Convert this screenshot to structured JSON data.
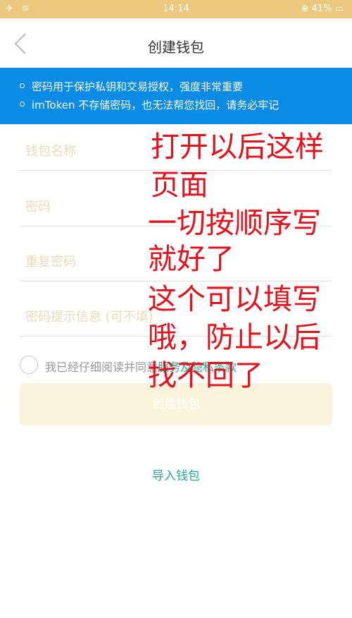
{
  "status_bar": {
    "time": "14:14",
    "battery": "41%"
  },
  "header": {
    "title": "创建钱包"
  },
  "notice": {
    "lines": [
      "密码用于保护私钥和交易授权，强度非常重要",
      "imToken 不存储密码，也无法帮您找回，请务必牢记"
    ]
  },
  "form": {
    "wallet_name_placeholder": "钱包名称",
    "password_placeholder": "密码",
    "repeat_password_placeholder": "重复密码",
    "hint_placeholder": "密码提示信息 (可不填)"
  },
  "agreement": {
    "text": "我已经仔细阅读并同意",
    "link": "服务及隐私条款"
  },
  "buttons": {
    "create": "创建钱包",
    "import": "导入钱包"
  },
  "annotations": [
    "打开以后这样",
    "页面",
    "一切按顺序写",
    "就好了",
    "这个可以填写",
    "哦，防止以后",
    "找不回了"
  ],
  "colors": {
    "status_bar": "#ecc77e",
    "notice_bg": "#0a8ce6",
    "link": "#2ba89a",
    "annotation": "#e4121b"
  }
}
